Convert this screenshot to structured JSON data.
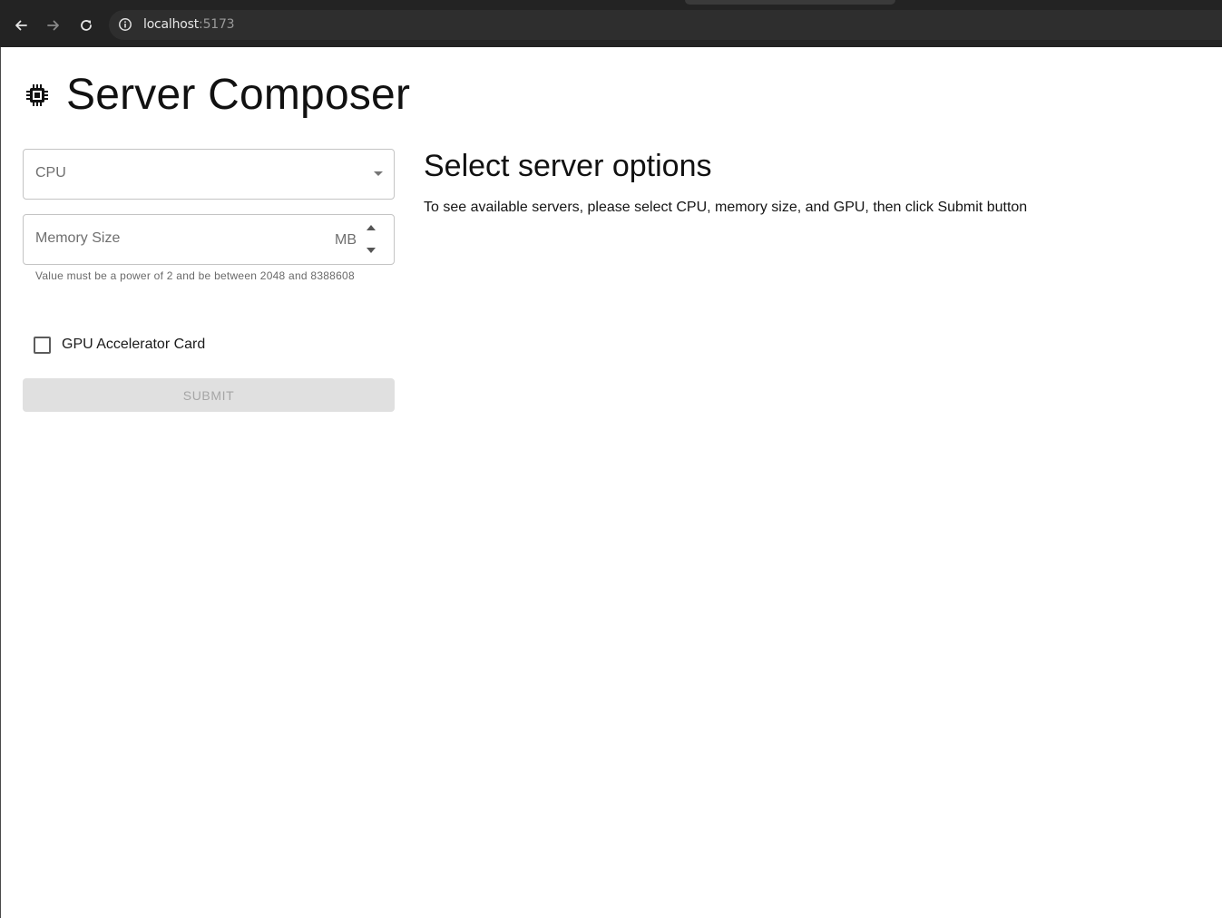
{
  "browser": {
    "url_host": "localhost",
    "url_port": ":5173",
    "icons": {
      "back": "arrow-left-icon",
      "forward": "arrow-right-icon",
      "reload": "reload-icon",
      "site_info": "info-icon"
    }
  },
  "app": {
    "title": "Server Composer",
    "icon": "chip-icon"
  },
  "form": {
    "cpu": {
      "label": "CPU",
      "selected": ""
    },
    "memory": {
      "label": "Memory Size",
      "unit": "MB",
      "value": "",
      "helper": "Value must be a power of 2 and be between 2048 and 8388608"
    },
    "gpu": {
      "label": "GPU Accelerator Card",
      "checked": false
    },
    "submit_label": "SUBMIT",
    "submit_disabled": true
  },
  "results": {
    "title": "Select server options",
    "description": "To see available servers, please select CPU, memory size, and GPU, then click Submit button"
  },
  "colors": {
    "chrome_bg": "#232323",
    "text_primary": "#111111",
    "field_border": "#c4c4c4",
    "button_disabled_bg": "#e0e0e0",
    "button_disabled_text": "#a6a6a6"
  }
}
